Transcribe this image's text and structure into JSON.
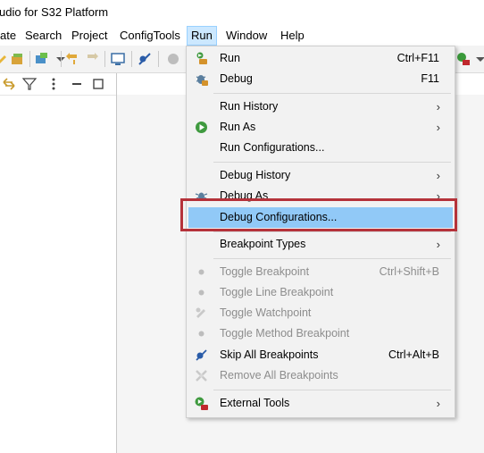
{
  "window": {
    "title_fragment": "udio for S32 Platform"
  },
  "menubar": {
    "items": [
      {
        "label": "ate"
      },
      {
        "label": "Search"
      },
      {
        "label": "Project"
      },
      {
        "label": "ConfigTools"
      },
      {
        "label": "Run"
      },
      {
        "label": "Window"
      },
      {
        "label": "Help"
      }
    ]
  },
  "run_menu": {
    "items": [
      {
        "label": "Run",
        "shortcut": "Ctrl+F11",
        "icon": "run-launch-icon"
      },
      {
        "label": "Debug",
        "shortcut": "F11",
        "icon": "debug-bug-icon"
      },
      {
        "label": "Run History",
        "submenu": "›"
      },
      {
        "label": "Run As",
        "submenu": "›",
        "icon": "run-green-circle-icon"
      },
      {
        "label": "Run Configurations..."
      },
      {
        "label": "Debug History",
        "submenu": "›"
      },
      {
        "label": "Debug As",
        "submenu": "›",
        "icon": "debug-as-icon"
      },
      {
        "label": "Debug Configurations..."
      },
      {
        "label": "Breakpoint Types",
        "submenu": "›"
      },
      {
        "label": "Toggle Breakpoint",
        "shortcut": "Ctrl+Shift+B"
      },
      {
        "label": "Toggle Line Breakpoint"
      },
      {
        "label": "Toggle Watchpoint"
      },
      {
        "label": "Toggle Method Breakpoint"
      },
      {
        "label": "Skip All Breakpoints",
        "shortcut": "Ctrl+Alt+B"
      },
      {
        "label": "Remove All Breakpoints"
      },
      {
        "label": "External Tools",
        "submenu": "›"
      }
    ]
  },
  "colors": {
    "highlight": "#91c9f7",
    "callout": "#b5323a",
    "active_menu": "#cce8ff"
  }
}
